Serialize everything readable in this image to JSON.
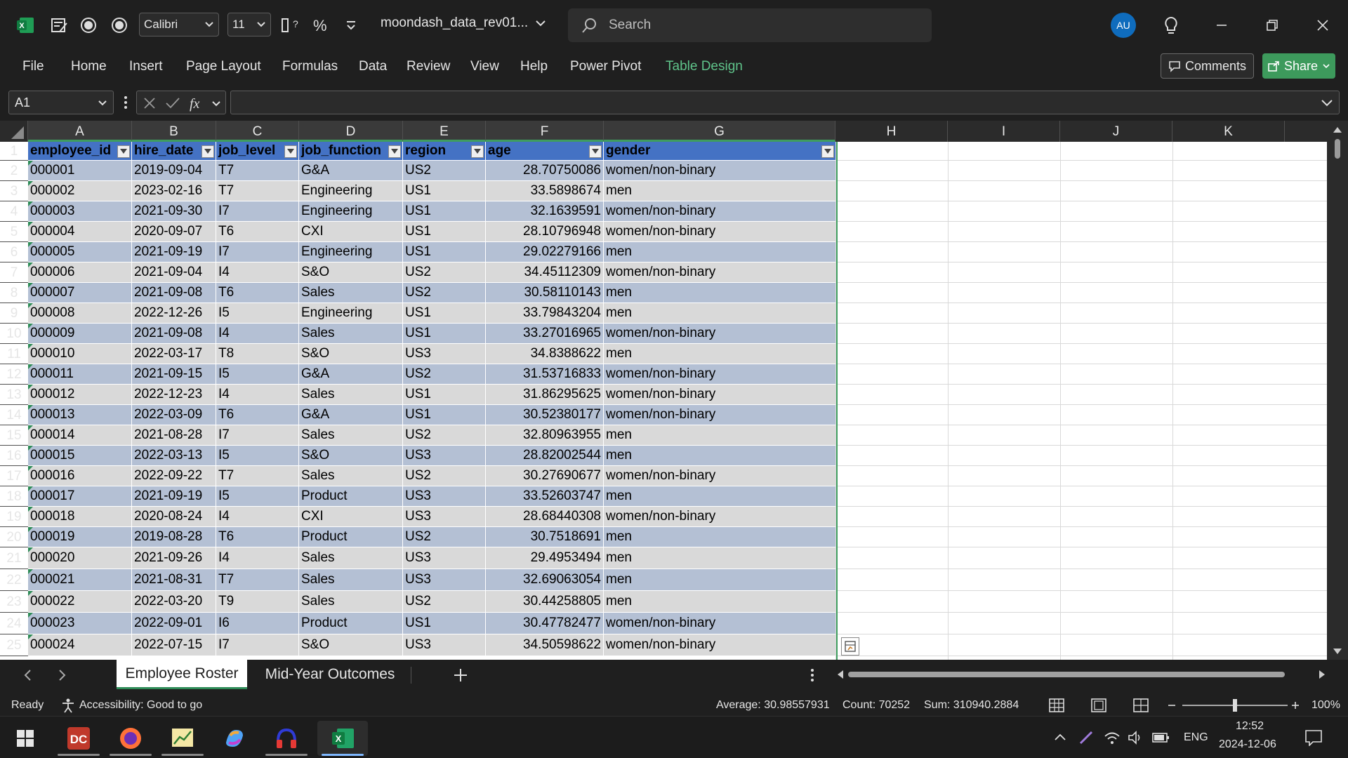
{
  "titlebar": {
    "font_name": "Calibri",
    "font_size": "11",
    "filename": "moondash_data_rev01...",
    "search_placeholder": "Search",
    "avatar_initials": "AU"
  },
  "ribbon": {
    "tabs": [
      "File",
      "Home",
      "Insert",
      "Page Layout",
      "Formulas",
      "Data",
      "Review",
      "View",
      "Help",
      "Power Pivot",
      "Table Design"
    ],
    "active_tab": "Table Design",
    "comments_label": "Comments",
    "share_label": "Share"
  },
  "formula_bar": {
    "name_box": "A1",
    "formula": ""
  },
  "columns": [
    "A",
    "B",
    "C",
    "D",
    "E",
    "F",
    "G",
    "H",
    "I",
    "J",
    "K"
  ],
  "table": {
    "headers": [
      "employee_id",
      "hire_date",
      "job_level",
      "job_function",
      "region",
      "age",
      "gender"
    ],
    "rows": [
      [
        "000001",
        "2019-09-04",
        "T7",
        "G&A",
        "US2",
        "28.70750086",
        "women/non-binary"
      ],
      [
        "000002",
        "2023-02-16",
        "T7",
        "Engineering",
        "US1",
        "33.5898674",
        "men"
      ],
      [
        "000003",
        "2021-09-30",
        "I7",
        "Engineering",
        "US1",
        "32.1639591",
        "women/non-binary"
      ],
      [
        "000004",
        "2020-09-07",
        "T6",
        "CXI",
        "US1",
        "28.10796948",
        "women/non-binary"
      ],
      [
        "000005",
        "2021-09-19",
        "I7",
        "Engineering",
        "US1",
        "29.02279166",
        "men"
      ],
      [
        "000006",
        "2021-09-04",
        "I4",
        "S&O",
        "US2",
        "34.45112309",
        "women/non-binary"
      ],
      [
        "000007",
        "2021-09-08",
        "T6",
        "Sales",
        "US2",
        "30.58110143",
        "men"
      ],
      [
        "000008",
        "2022-12-26",
        "I5",
        "Engineering",
        "US1",
        "33.79843204",
        "men"
      ],
      [
        "000009",
        "2021-09-08",
        "I4",
        "Sales",
        "US1",
        "33.27016965",
        "women/non-binary"
      ],
      [
        "000010",
        "2022-03-17",
        "T8",
        "S&O",
        "US3",
        "34.8388622",
        "men"
      ],
      [
        "000011",
        "2021-09-15",
        "I5",
        "G&A",
        "US2",
        "31.53716833",
        "women/non-binary"
      ],
      [
        "000012",
        "2022-12-23",
        "I4",
        "Sales",
        "US1",
        "31.86295625",
        "women/non-binary"
      ],
      [
        "000013",
        "2022-03-09",
        "T6",
        "G&A",
        "US1",
        "30.52380177",
        "women/non-binary"
      ],
      [
        "000014",
        "2021-08-28",
        "I7",
        "Sales",
        "US2",
        "32.80963955",
        "men"
      ],
      [
        "000015",
        "2022-03-13",
        "I5",
        "S&O",
        "US3",
        "28.82002544",
        "men"
      ],
      [
        "000016",
        "2022-09-22",
        "T7",
        "Sales",
        "US2",
        "30.27690677",
        "women/non-binary"
      ],
      [
        "000017",
        "2021-09-19",
        "I5",
        "Product",
        "US3",
        "33.52603747",
        "men"
      ],
      [
        "000018",
        "2020-08-24",
        "I4",
        "CXI",
        "US3",
        "28.68440308",
        "women/non-binary"
      ],
      [
        "000019",
        "2019-08-28",
        "T6",
        "Product",
        "US2",
        "30.7518691",
        "men"
      ],
      [
        "000020",
        "2021-09-26",
        "I4",
        "Sales",
        "US3",
        "29.4953494",
        "men"
      ],
      [
        "000021",
        "2021-08-31",
        "T7",
        "Sales",
        "US3",
        "32.69063054",
        "men"
      ],
      [
        "000022",
        "2022-03-20",
        "T9",
        "Sales",
        "US2",
        "30.44258805",
        "men"
      ],
      [
        "000023",
        "2022-09-01",
        "I6",
        "Product",
        "US1",
        "30.47782477",
        "women/non-binary"
      ],
      [
        "000024",
        "2022-07-15",
        "I7",
        "S&O",
        "US3",
        "34.50598622",
        "women/non-binary"
      ]
    ]
  },
  "sheets": {
    "active": "Employee Roster",
    "other": "Mid-Year Outcomes"
  },
  "status": {
    "ready": "Ready",
    "accessibility": "Accessibility: Good to go",
    "average": "Average: 30.98557931",
    "count": "Count: 70252",
    "sum": "Sum: 310940.2884",
    "zoom": "100%"
  },
  "taskbar": {
    "language": "ENG",
    "time": "12:52",
    "date": "2024-12-06"
  },
  "colors": {
    "table_header": "#4472c4",
    "row_band_dark": "#b4c0d4",
    "row_band_light": "#d9d9d9",
    "accent_green": "#3d9a5c"
  }
}
